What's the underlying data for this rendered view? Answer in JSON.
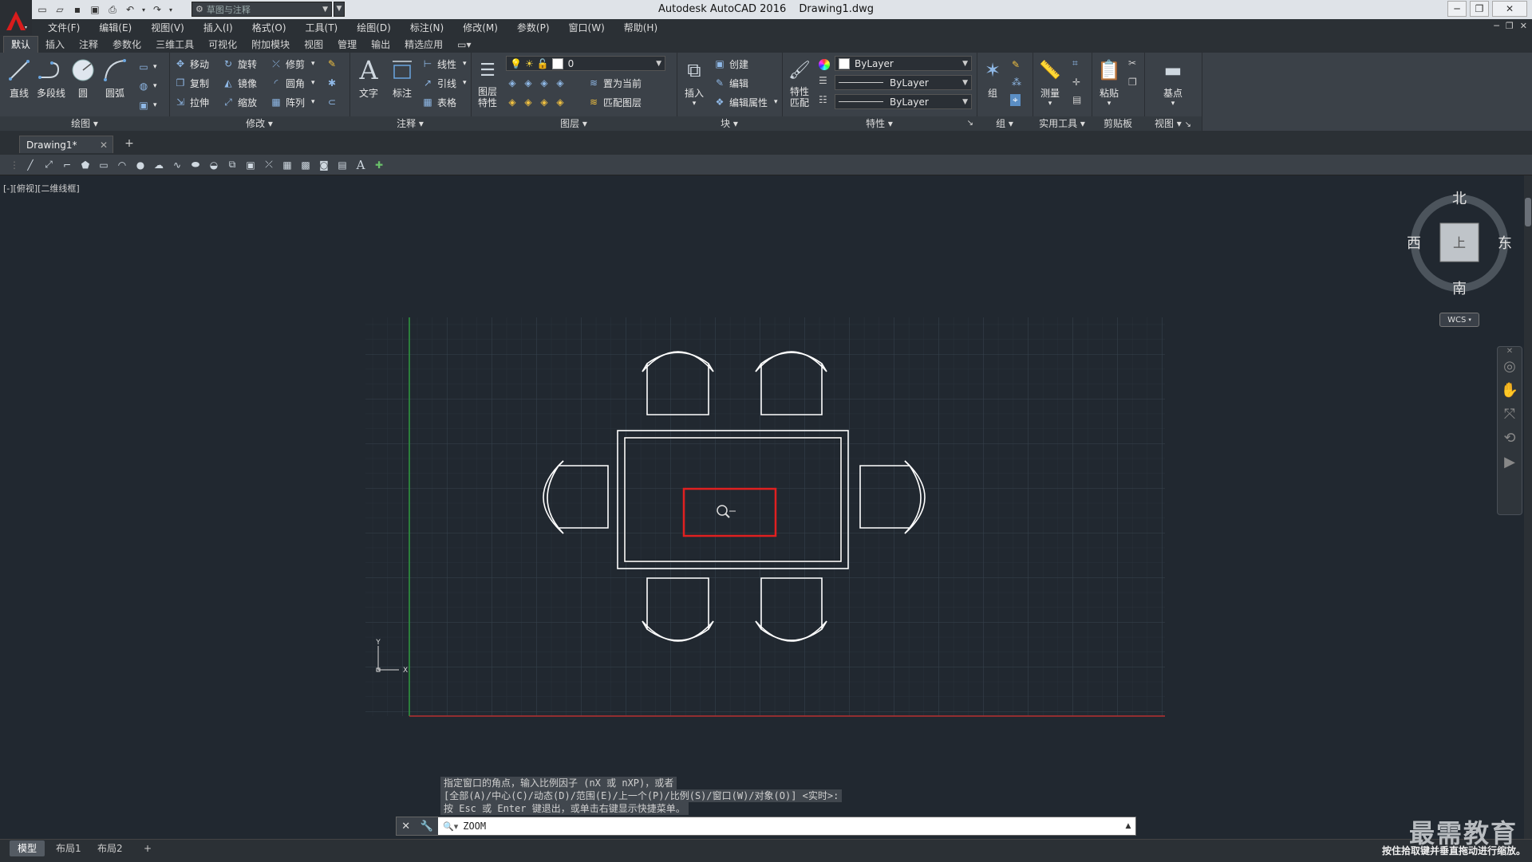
{
  "window": {
    "app_title": "Autodesk AutoCAD 2016",
    "doc_title": "Drawing1.dwg",
    "workspace": "草图与注释"
  },
  "menu": [
    "文件(F)",
    "编辑(E)",
    "视图(V)",
    "插入(I)",
    "格式(O)",
    "工具(T)",
    "绘图(D)",
    "标注(N)",
    "修改(M)",
    "参数(P)",
    "窗口(W)",
    "帮助(H)"
  ],
  "ribbon_tabs": [
    "默认",
    "插入",
    "注释",
    "参数化",
    "三维工具",
    "可视化",
    "附加模块",
    "视图",
    "管理",
    "输出",
    "精选应用"
  ],
  "ribbon": {
    "draw": {
      "label": "绘图",
      "line": "直线",
      "polyline": "多段线",
      "circle": "圆",
      "arc": "圆弧"
    },
    "modify": {
      "label": "修改",
      "move": "移动",
      "rotate": "旋转",
      "trim": "修剪",
      "copy": "复制",
      "mirror": "镜像",
      "fillet": "圆角",
      "stretch": "拉伸",
      "scale": "缩放",
      "array": "阵列"
    },
    "annotation": {
      "label": "注释",
      "text": "文字",
      "dimension": "标注",
      "linear": "线性",
      "leader": "引线",
      "table": "表格"
    },
    "layers": {
      "label": "图层",
      "props": "图层\n特性",
      "layer_name": "0",
      "set_current": "置为当前",
      "match": "匹配图层"
    },
    "block": {
      "label": "块",
      "insert": "插入",
      "create": "创建",
      "edit": "编辑",
      "edit_attr": "编辑属性"
    },
    "properties": {
      "label": "特性",
      "match": "特性\n匹配",
      "color": "ByLayer",
      "linetype": "ByLayer",
      "lineweight": "ByLayer"
    },
    "groups": {
      "label": "组",
      "group": "组"
    },
    "utilities": {
      "label": "实用工具",
      "measure": "测量"
    },
    "clipboard": {
      "label": "剪贴板",
      "paste": "粘贴"
    },
    "view": {
      "label": "视图",
      "base": "基点"
    }
  },
  "doc_tab": "Drawing1*",
  "viewport_label": "[-][俯视][二维线框]",
  "viewcube": {
    "north": "北",
    "south": "南",
    "east": "东",
    "west": "西",
    "face": "上",
    "wcs": "WCS"
  },
  "axis": {
    "x": "X",
    "y": "Y"
  },
  "command": {
    "history": [
      "指定窗口的角点，输入比例因子 (nX 或 nXP)，或者",
      "[全部(A)/中心(C)/动态(D)/范围(E)/上一个(P)/比例(S)/窗口(W)/对象(O)] <实时>:",
      "按 Esc 或 Enter 键退出，或单击右键显示快捷菜单。"
    ],
    "input": "ZOOM"
  },
  "layout_tabs": [
    "模型",
    "布局1",
    "布局2"
  ],
  "status_hint": "按住拾取键并垂直拖动进行缩放。",
  "watermark": "最需教育",
  "colors": {
    "background": "#212830",
    "grid": "#2c3640",
    "highlight": "#e02020",
    "x_axis": "#b83030",
    "y_axis": "#2f9a3f"
  }
}
